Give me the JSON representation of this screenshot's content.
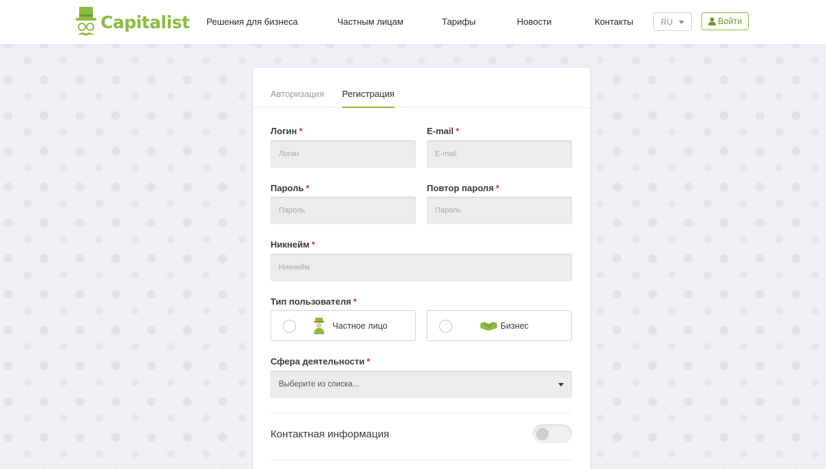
{
  "header": {
    "brand": "Capitalist",
    "nav": [
      "Решения для бизнеса",
      "Частным лицам",
      "Тарифы",
      "Новости",
      "Контакты"
    ],
    "language": "RU",
    "login_label": "Войти"
  },
  "tabs": {
    "login": "Авторизация",
    "register": "Регистрация",
    "active": "register"
  },
  "form": {
    "login": {
      "label": "Логин",
      "placeholder": "Логин",
      "required": "*"
    },
    "email": {
      "label": "E-mail",
      "placeholder": "E-mail",
      "required": "*"
    },
    "password": {
      "label": "Пароль",
      "placeholder": "Пароль",
      "required": "*"
    },
    "password_repeat": {
      "label": "Повтор пароля",
      "placeholder": "Пароль",
      "required": "*"
    },
    "nickname": {
      "label": "Никнейм",
      "placeholder": "Никнейм",
      "required": "*"
    },
    "user_type": {
      "label": "Тип пользователя",
      "required": "*",
      "options": [
        "Частное лицо",
        "Бизнес"
      ]
    },
    "activity": {
      "label": "Сфера деятельности",
      "required": "*",
      "value": "Выберите из списка..."
    },
    "contact_info": {
      "label": "Контактная информация",
      "enabled": false
    }
  },
  "colors": {
    "brand_green": "#8dba42",
    "required_red": "#d9342b",
    "background": "#efeff5"
  },
  "icons": {
    "logo": "top-hat-mustache-logo",
    "login": "user-icon",
    "private_person": "person-icon",
    "business": "handshake-icon"
  }
}
